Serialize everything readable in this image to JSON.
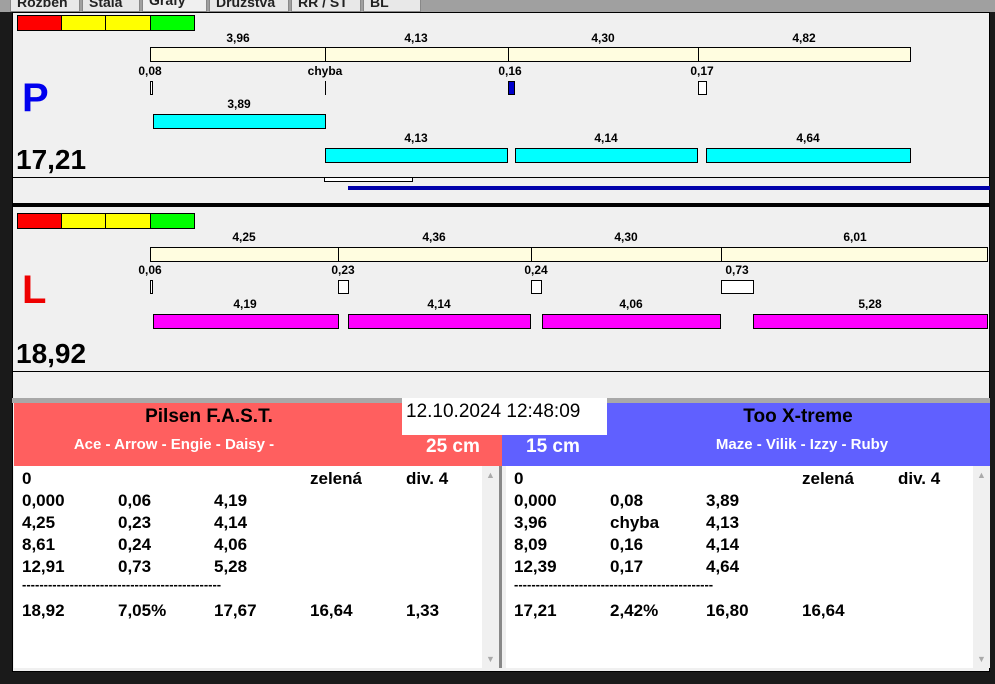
{
  "tabs": [
    "Rozběh",
    "Stala",
    "Grafy",
    "Družstva",
    "RR / ST",
    "BL"
  ],
  "colors": {
    "red": "#ff0000",
    "yellow": "#ffff00",
    "green": "#00ff00",
    "team_left": "#ff5f5f",
    "team_right": "#6060ff",
    "cyan": "#00ffff",
    "magenta": "#ff00ff"
  },
  "panel_p": {
    "letter": "P",
    "total": "17,21",
    "split_labels": [
      "3,96",
      "4,13",
      "4,30",
      "4,82"
    ],
    "reaction_labels": [
      "0,08",
      "chyba",
      "0,16",
      "0,17"
    ],
    "first_bar": "3,89",
    "bar_labels": [
      "4,13",
      "4,14",
      "4,64"
    ]
  },
  "panel_l": {
    "letter": "L",
    "total": "18,92",
    "split_labels": [
      "4,25",
      "4,36",
      "4,30",
      "6,01"
    ],
    "reaction_labels": [
      "0,06",
      "0,23",
      "0,24",
      "0,73"
    ],
    "bar_labels": [
      "4,19",
      "4,14",
      "4,06",
      "5,28"
    ]
  },
  "datetime": "12.10.2024 12:48:09",
  "left_team": {
    "name": "Pilsen F.A.S.T.",
    "members": "Ace - Arrow - Engie - Daisy -",
    "distance": "25 cm",
    "header": [
      "0",
      "",
      "",
      "zelená",
      "div. 4"
    ],
    "rows": [
      [
        "0,000",
        "0,06",
        "4,19"
      ],
      [
        "4,25",
        "0,23",
        "4,14"
      ],
      [
        "8,61",
        "0,24",
        "4,06"
      ],
      [
        "12,91",
        "0,73",
        "5,28"
      ]
    ],
    "separator": "----------------------------------------------",
    "totals": [
      "18,92",
      "7,05%",
      "17,67",
      "16,64",
      "1,33"
    ]
  },
  "right_team": {
    "name": "Too X-treme",
    "members": "Maze - Vilik - Izzy - Ruby",
    "distance": "15 cm",
    "header": [
      "0",
      "",
      "",
      "zelená",
      "div. 4"
    ],
    "rows": [
      [
        "0,000",
        "0,08",
        "3,89"
      ],
      [
        "3,96",
        "chyba",
        "4,13"
      ],
      [
        "8,09",
        "0,16",
        "4,14"
      ],
      [
        "12,39",
        "0,17",
        "4,64"
      ]
    ],
    "separator": "----------------------------------------------",
    "totals": [
      "17,21",
      "2,42%",
      "16,80",
      "16,64",
      ""
    ]
  }
}
